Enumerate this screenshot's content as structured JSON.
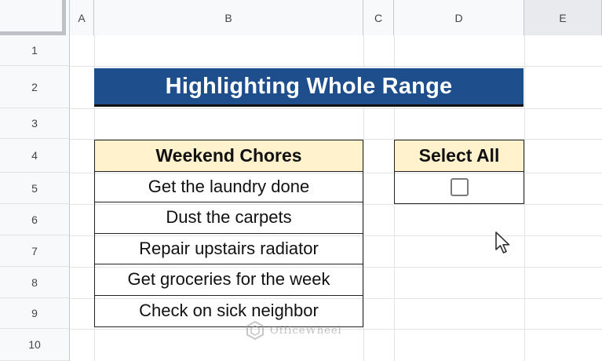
{
  "columns": [
    "A",
    "B",
    "C",
    "D",
    "E"
  ],
  "rows": [
    "1",
    "2",
    "3",
    "4",
    "5",
    "6",
    "7",
    "8",
    "9",
    "10"
  ],
  "title": "Highlighting Whole Range",
  "chores": {
    "header": "Weekend Chores",
    "items": [
      "Get the laundry done",
      "Dust the carpets",
      "Repair upstairs radiator",
      "Get groceries for the week",
      "Check on sick neighbor"
    ]
  },
  "select_all": {
    "header": "Select All",
    "checked": false
  },
  "watermark": "OfficeWheel",
  "colors": {
    "banner": "#1f4e8c",
    "header_fill": "#fff2cc",
    "grid": "#e2e3e3"
  },
  "icons": {
    "cursor": "mouse-pointer-icon",
    "watermark": "officewheel-logo-icon"
  }
}
